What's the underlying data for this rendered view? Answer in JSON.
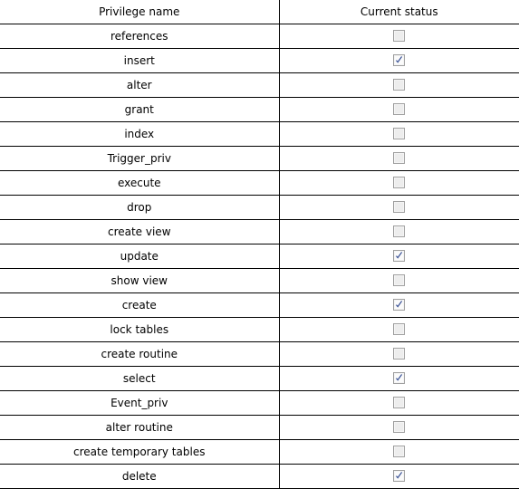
{
  "table": {
    "columns": [
      {
        "key": "privilege_name",
        "label": "Privilege name"
      },
      {
        "key": "current_status",
        "label": "Current status"
      }
    ],
    "rows": [
      {
        "privilege_name": "references",
        "checked": false,
        "checkbox_state": "unchecked"
      },
      {
        "privilege_name": "insert",
        "checked": true,
        "checkbox_state": "checked"
      },
      {
        "privilege_name": "alter",
        "checked": false,
        "checkbox_state": "unchecked"
      },
      {
        "privilege_name": "grant",
        "checked": false,
        "checkbox_state": "unchecked"
      },
      {
        "privilege_name": "index",
        "checked": false,
        "checkbox_state": "unchecked"
      },
      {
        "privilege_name": "Trigger_priv",
        "checked": false,
        "checkbox_state": "unchecked"
      },
      {
        "privilege_name": "execute",
        "checked": false,
        "checkbox_state": "unchecked"
      },
      {
        "privilege_name": "drop",
        "checked": false,
        "checkbox_state": "unchecked"
      },
      {
        "privilege_name": "create view",
        "checked": false,
        "checkbox_state": "unchecked"
      },
      {
        "privilege_name": "update",
        "checked": true,
        "checkbox_state": "checked"
      },
      {
        "privilege_name": "show view",
        "checked": false,
        "checkbox_state": "unchecked"
      },
      {
        "privilege_name": "create",
        "checked": true,
        "checkbox_state": "checked"
      },
      {
        "privilege_name": "lock tables",
        "checked": false,
        "checkbox_state": "unchecked"
      },
      {
        "privilege_name": "create routine",
        "checked": false,
        "checkbox_state": "unchecked"
      },
      {
        "privilege_name": "select",
        "checked": true,
        "checkbox_state": "checked"
      },
      {
        "privilege_name": "Event_priv",
        "checked": false,
        "checkbox_state": "unchecked"
      },
      {
        "privilege_name": "alter routine",
        "checked": false,
        "checkbox_state": "unchecked"
      },
      {
        "privilege_name": "create temporary tables",
        "checked": false,
        "checkbox_state": "unchecked"
      },
      {
        "privilege_name": "delete",
        "checked": true,
        "checkbox_state": "checked"
      }
    ]
  },
  "colors": {
    "border": "#000000",
    "text": "#000000",
    "background": "#ffffff",
    "checkbox_border": "#a0a0a0",
    "checkbox_fill_unchecked": "#ededed",
    "checkbox_fill_checked": "#fbfbfb",
    "checkmark": "#3a5296"
  },
  "icons": {
    "checkbox_checked": "checkbox-checked-icon",
    "checkbox_unchecked": "checkbox-unchecked-icon"
  }
}
